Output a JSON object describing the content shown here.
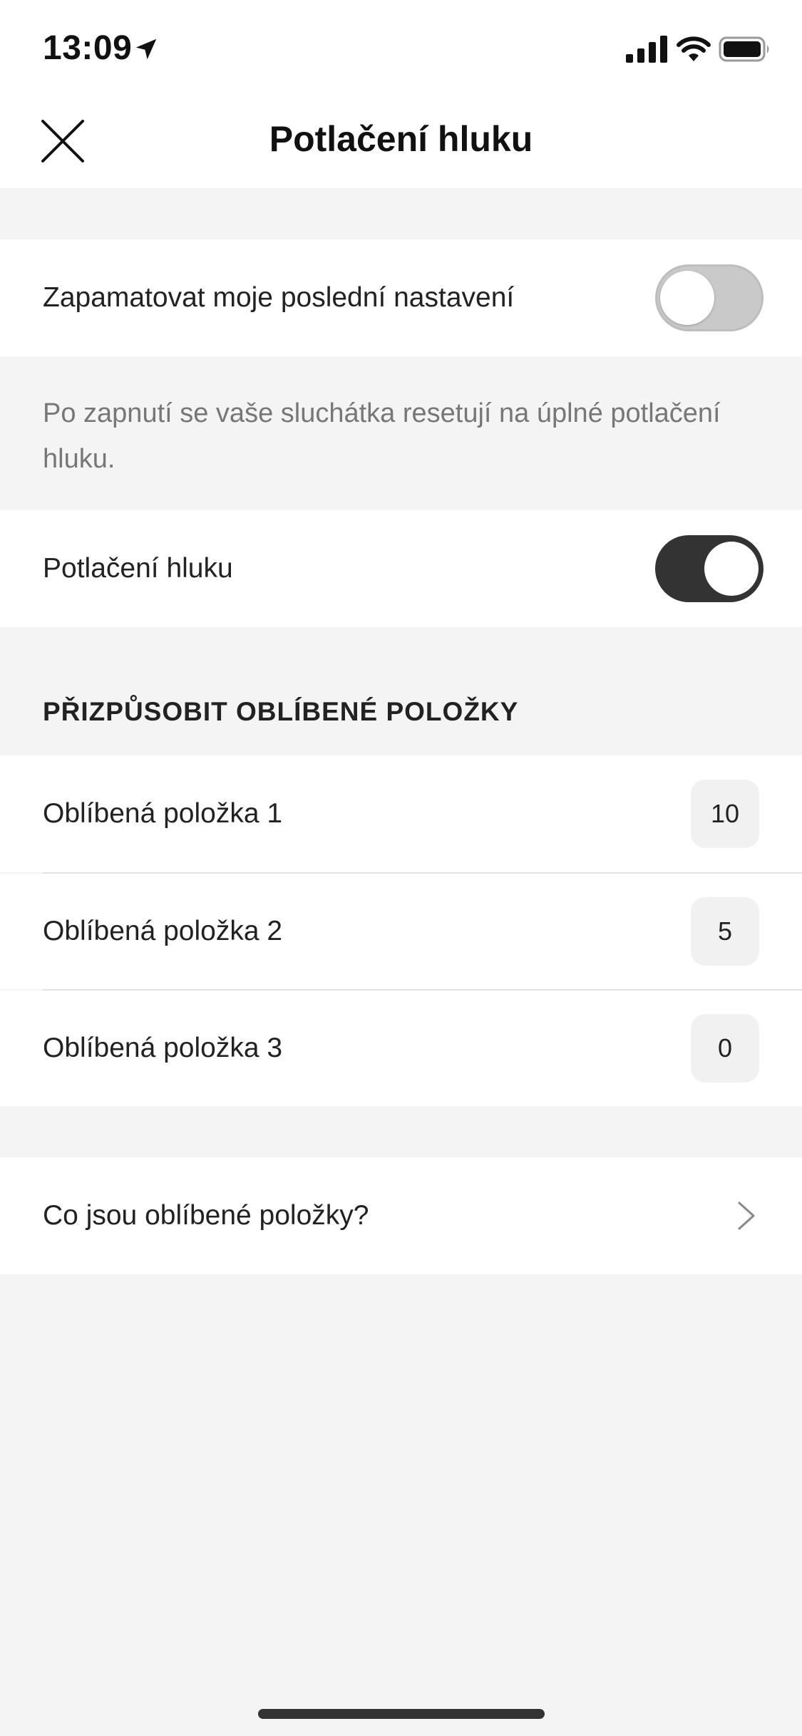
{
  "status_bar": {
    "time": "13:09",
    "location_icon": "location-arrow-icon",
    "signal_icon": "cellular-signal-icon",
    "wifi_icon": "wifi-icon",
    "battery_icon": "battery-icon"
  },
  "nav": {
    "title": "Potlačení hluku",
    "close_icon": "close-icon"
  },
  "settings": {
    "remember_last": {
      "label": "Zapamatovat moje poslední nastavení",
      "enabled": false
    },
    "info_text": "Po zapnutí se vaše sluchátka resetují na úplné potlačení hluku.",
    "noise_cancel": {
      "label": "Potlačení hluku",
      "enabled": true
    }
  },
  "favorites": {
    "header": "PŘIZPŮSOBIT OBLÍBENÉ POLOŽKY",
    "items": [
      {
        "label": "Oblíbená položka 1",
        "value": "10"
      },
      {
        "label": "Oblíbená položka 2",
        "value": "5"
      },
      {
        "label": "Oblíbená položka 3",
        "value": "0"
      }
    ]
  },
  "help_link": {
    "label": "Co jsou oblíbené položky?",
    "icon": "chevron-right-icon"
  },
  "colors": {
    "background": "#f4f4f4",
    "surface": "#ffffff",
    "toggle_on": "#333333",
    "toggle_off": "#c9c9c9",
    "secondary_text": "#777777"
  }
}
